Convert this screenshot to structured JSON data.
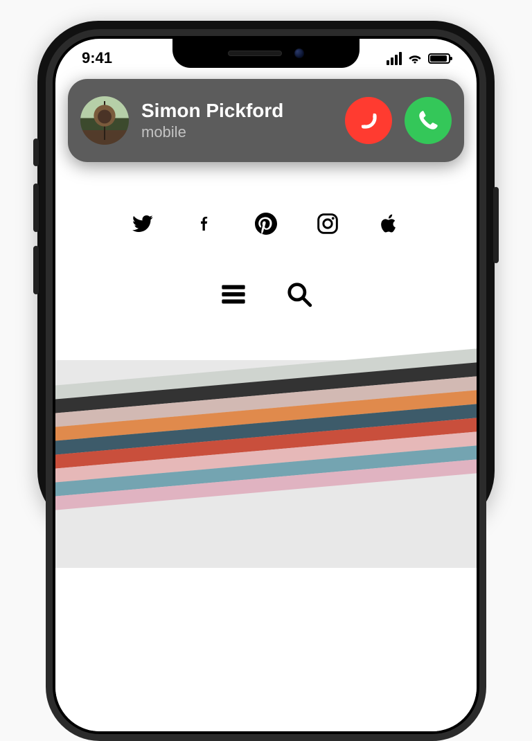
{
  "status": {
    "time": "9:41"
  },
  "call": {
    "caller_name": "Simon Pickford",
    "caller_subtitle": "mobile"
  }
}
